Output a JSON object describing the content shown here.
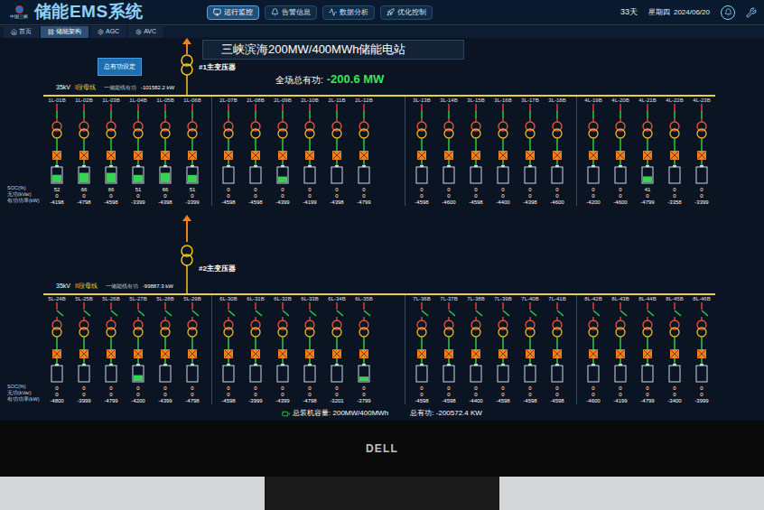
{
  "header": {
    "logo": "中国三峡",
    "title": "储能EMS系统",
    "nav": [
      {
        "label": "运行监控",
        "selected": true
      },
      {
        "label": "告警信息",
        "selected": false
      },
      {
        "label": "数据分析",
        "selected": false
      },
      {
        "label": "优化控制",
        "selected": false
      }
    ],
    "days": "33天",
    "weekday": "星期四",
    "date": "2024/06/20"
  },
  "subtabs": [
    {
      "label": "首页",
      "selected": false
    },
    {
      "label": "储能架构",
      "selected": true
    },
    {
      "label": "AGC",
      "selected": false
    },
    {
      "label": "AVC",
      "selected": false
    }
  ],
  "station": {
    "title": "三峡滨海200MW/400MWh储能电站",
    "total_label": "全场总有功:",
    "total_value": "-200.6 MW",
    "setpoint_button": "总有功设定"
  },
  "row_labels": [
    "SOC(%)",
    "无功(kVar)",
    "有功功率(kW)"
  ],
  "sections": [
    {
      "transformer": "#1主变压器",
      "voltage": "35kV",
      "bus": "I段母线",
      "line_label": "一储能线有功",
      "line_power": "-101582.2 kW",
      "groups": [
        {
          "bays": [
            {
              "name": "1L-01B",
              "soc": "52",
              "reactive": "0",
              "active": "-4198",
              "level": 0.52,
              "closed": true
            },
            {
              "name": "1L-02B",
              "soc": "66",
              "reactive": "0",
              "active": "-4798",
              "level": 0.66,
              "closed": true
            },
            {
              "name": "1L-03B",
              "soc": "66",
              "reactive": "0",
              "active": "-4598",
              "level": 0.66,
              "closed": true
            },
            {
              "name": "1L-04B",
              "soc": "51",
              "reactive": "0",
              "active": "-3399",
              "level": 0.51,
              "closed": true
            },
            {
              "name": "1L-05B",
              "soc": "66",
              "reactive": "0",
              "active": "-4398",
              "level": 0.66,
              "closed": true
            },
            {
              "name": "1L-06B",
              "soc": "51",
              "reactive": "0",
              "active": "-3399",
              "level": 0.51,
              "closed": true
            }
          ]
        },
        {
          "bays": [
            {
              "name": "2L-07B",
              "soc": "0",
              "reactive": "0",
              "active": "-4598",
              "level": 0,
              "closed": true
            },
            {
              "name": "2L-08B",
              "soc": "0",
              "reactive": "0",
              "active": "-4598",
              "level": 0,
              "closed": true
            },
            {
              "name": "2L-09B",
              "soc": "0",
              "reactive": "0",
              "active": "-4399",
              "level": 0.4,
              "closed": true
            },
            {
              "name": "2L-10B",
              "soc": "0",
              "reactive": "0",
              "active": "-4199",
              "level": 0,
              "closed": true
            },
            {
              "name": "2L-11B",
              "soc": "0",
              "reactive": "0",
              "active": "-4398",
              "level": 0,
              "closed": true
            },
            {
              "name": "2L-12B",
              "soc": "0",
              "reactive": "0",
              "active": "-4799",
              "level": 0,
              "closed": true
            }
          ]
        },
        {
          "bays": [
            {
              "name": "3L-13B",
              "soc": "0",
              "reactive": "0",
              "active": "-4598",
              "level": 0,
              "closed": true
            },
            {
              "name": "3L-14B",
              "soc": "0",
              "reactive": "0",
              "active": "-4600",
              "level": 0,
              "closed": true
            },
            {
              "name": "3L-15B",
              "soc": "0",
              "reactive": "0",
              "active": "-4598",
              "level": 0,
              "closed": true
            },
            {
              "name": "3L-16B",
              "soc": "0",
              "reactive": "0",
              "active": "-4400",
              "level": 0,
              "closed": true
            },
            {
              "name": "3L-17B",
              "soc": "0",
              "reactive": "0",
              "active": "-4398",
              "level": 0,
              "closed": true
            },
            {
              "name": "3L-18B",
              "soc": "0",
              "reactive": "0",
              "active": "-4600",
              "level": 0,
              "closed": true
            }
          ]
        },
        {
          "bays": [
            {
              "name": "4L-19B",
              "soc": "0",
              "reactive": "0",
              "active": "-4200",
              "level": 0,
              "closed": true
            },
            {
              "name": "4L-20B",
              "soc": "0",
              "reactive": "0",
              "active": "-4600",
              "level": 0,
              "closed": true
            },
            {
              "name": "4L-21B",
              "soc": "41",
              "reactive": "0",
              "active": "-4799",
              "level": 0.41,
              "closed": true
            },
            {
              "name": "4L-22B",
              "soc": "0",
              "reactive": "0",
              "active": "-3358",
              "level": 0,
              "closed": true
            },
            {
              "name": "4L-23B",
              "soc": "0",
              "reactive": "0",
              "active": "-3399",
              "level": 0,
              "closed": true
            }
          ]
        }
      ]
    },
    {
      "transformer": "#2主变压器",
      "voltage": "35kV",
      "bus": "II段母线",
      "line_label": "一储能线有功",
      "line_power": "-99887.3 kW",
      "groups": [
        {
          "bays": [
            {
              "name": "5L-24B",
              "soc": "0",
              "reactive": "0",
              "active": "-4800",
              "level": 0,
              "closed": false
            },
            {
              "name": "5L-25B",
              "soc": "0",
              "reactive": "0",
              "active": "-3999",
              "level": 0,
              "closed": false
            },
            {
              "name": "5L-26B",
              "soc": "0",
              "reactive": "0",
              "active": "-4799",
              "level": 0,
              "closed": false
            },
            {
              "name": "5L-27B",
              "soc": "0",
              "reactive": "0",
              "active": "-4200",
              "level": 0.4,
              "closed": false
            },
            {
              "name": "5L-28B",
              "soc": "0",
              "reactive": "0",
              "active": "-4399",
              "level": 0,
              "closed": false
            },
            {
              "name": "5L-29B",
              "soc": "0",
              "reactive": "0",
              "active": "-4798",
              "level": 0,
              "closed": false
            }
          ]
        },
        {
          "bays": [
            {
              "name": "6L-30B",
              "soc": "0",
              "reactive": "0",
              "active": "-4598",
              "level": 0,
              "closed": false
            },
            {
              "name": "6L-31B",
              "soc": "0",
              "reactive": "0",
              "active": "-3999",
              "level": 0,
              "closed": false
            },
            {
              "name": "6L-32B",
              "soc": "0",
              "reactive": "0",
              "active": "-4399",
              "level": 0,
              "closed": false
            },
            {
              "name": "6L-33B",
              "soc": "0",
              "reactive": "0",
              "active": "-4798",
              "level": 0,
              "closed": false
            },
            {
              "name": "6L-34B",
              "soc": "0",
              "reactive": "0",
              "active": "-3201",
              "level": 0,
              "closed": false
            },
            {
              "name": "6L-35B",
              "soc": "0",
              "reactive": "0",
              "active": "-3799",
              "level": 0.3,
              "closed": false
            }
          ]
        },
        {
          "bays": [
            {
              "name": "7L-36B",
              "soc": "0",
              "reactive": "0",
              "active": "-4598",
              "level": 0,
              "closed": false
            },
            {
              "name": "7L-37B",
              "soc": "0",
              "reactive": "0",
              "active": "-4598",
              "level": 0,
              "closed": false
            },
            {
              "name": "7L-38B",
              "soc": "0",
              "reactive": "0",
              "active": "-4400",
              "level": 0,
              "closed": false
            },
            {
              "name": "7L-39B",
              "soc": "0",
              "reactive": "0",
              "active": "-4598",
              "level": 0,
              "closed": false
            },
            {
              "name": "7L-40B",
              "soc": "0",
              "reactive": "0",
              "active": "-4598",
              "level": 0,
              "closed": false
            },
            {
              "name": "7L-41B",
              "soc": "0",
              "reactive": "0",
              "active": "-4598",
              "level": 0,
              "closed": false
            }
          ]
        },
        {
          "bays": [
            {
              "name": "8L-42B",
              "soc": "0",
              "reactive": "0",
              "active": "-4600",
              "level": 0,
              "closed": false
            },
            {
              "name": "8L-43B",
              "soc": "0",
              "reactive": "0",
              "active": "-4199",
              "level": 0,
              "closed": false
            },
            {
              "name": "8L-44B",
              "soc": "0",
              "reactive": "0",
              "active": "-4799",
              "level": 0,
              "closed": false
            },
            {
              "name": "8L-45B",
              "soc": "0",
              "reactive": "0",
              "active": "-3400",
              "level": 0,
              "closed": false
            },
            {
              "name": "8L-46B",
              "soc": "0",
              "reactive": "0",
              "active": "-3999",
              "level": 0,
              "closed": false
            }
          ]
        }
      ]
    }
  ],
  "footer": {
    "capacity": "总装机容量: 200MW/400MWh",
    "total": "总有功: -200572.4 KW"
  },
  "monitor": {
    "brand": "DELL"
  }
}
